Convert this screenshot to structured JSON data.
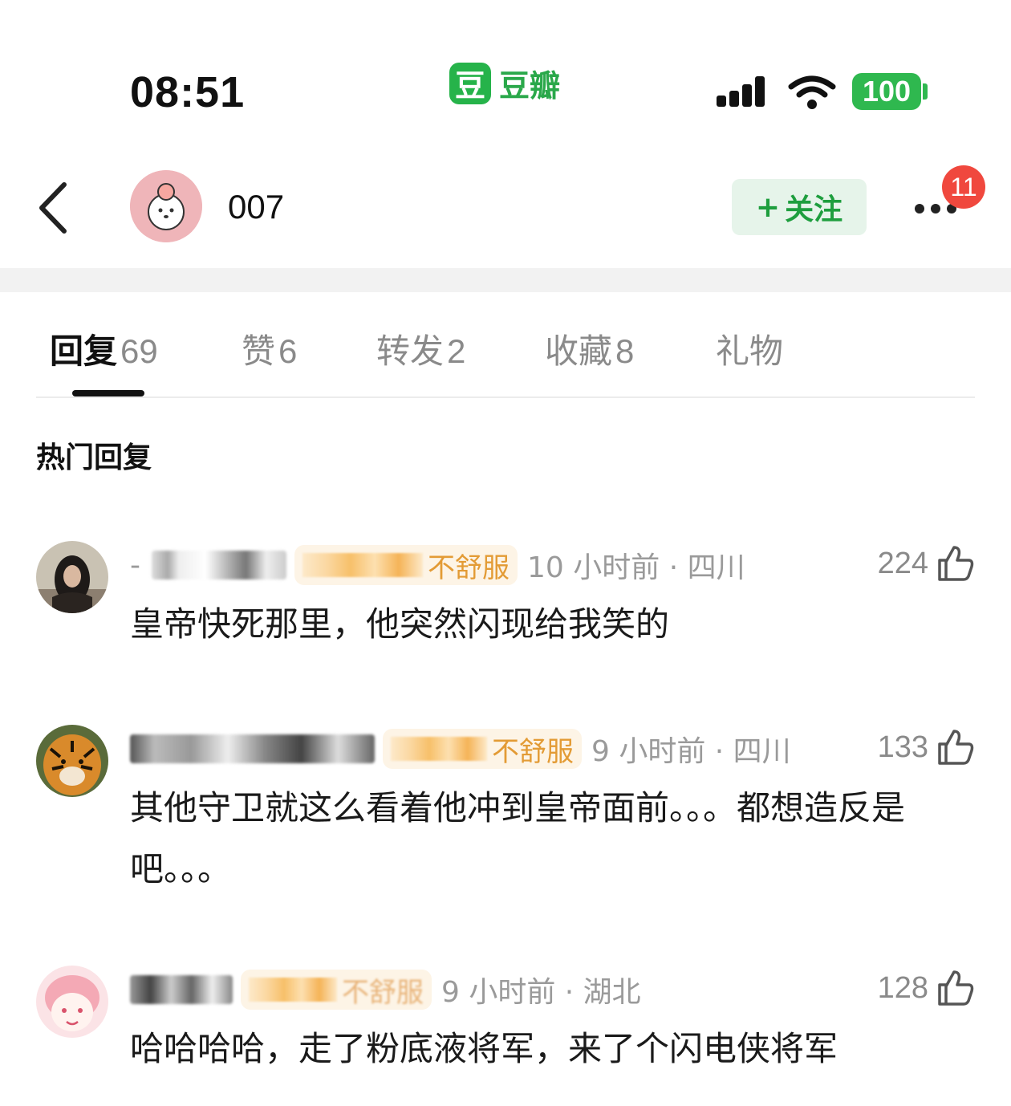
{
  "status_bar": {
    "time": "08:51",
    "app_logo_char": "豆",
    "app_name": "豆瓣",
    "battery": "100",
    "icons": [
      "signal-icon",
      "wifi-icon",
      "battery-icon"
    ]
  },
  "header": {
    "username": "007",
    "follow_label": "关注",
    "follow_plus": "+",
    "notification_count": "11"
  },
  "tabs": [
    {
      "label": "回复",
      "count": "69"
    },
    {
      "label": "赞",
      "count": "6"
    },
    {
      "label": "转发",
      "count": "2"
    },
    {
      "label": "收藏",
      "count": "8"
    },
    {
      "label": "礼物",
      "count": ""
    }
  ],
  "section_title": "热门回复",
  "comments": [
    {
      "name_prefix": "-",
      "tag": "不舒服",
      "time_location": "10 小时前 · 四川",
      "likes": "224",
      "text": "皇帝快死那里，他突然闪现给我笑的"
    },
    {
      "name_prefix": "",
      "tag": "不舒服",
      "time_location": "9 小时前 · 四川",
      "likes": "133",
      "text": "其他守卫就这么看着他冲到皇帝面前。。。都想造反是吧。。。"
    },
    {
      "name_prefix": "",
      "tag": "不舒服",
      "time_location": "9 小时前 · 湖北",
      "likes": "128",
      "text": "哈哈哈哈，走了粉底液将军，来了个闪电侠将军"
    }
  ],
  "colors": {
    "accent_green": "#1e9e3e",
    "follow_bg": "#e6f4ea",
    "badge_red": "#f0483e",
    "tag_orange": "#e39b35"
  }
}
